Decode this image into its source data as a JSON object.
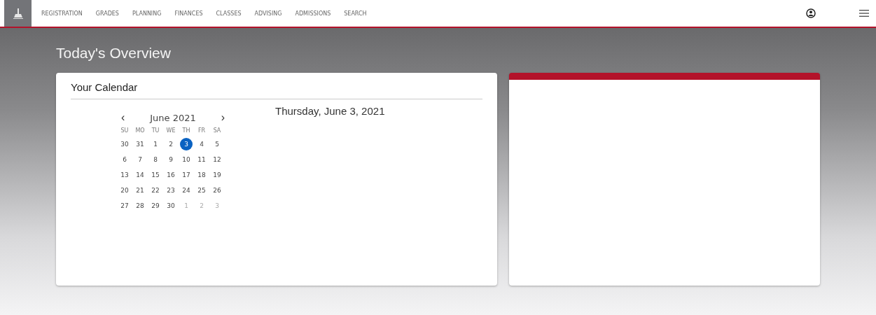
{
  "nav": {
    "items": [
      {
        "label": "REGISTRATION"
      },
      {
        "label": "GRADES"
      },
      {
        "label": "PLANNING"
      },
      {
        "label": "FINANCES"
      },
      {
        "label": "CLASSES"
      },
      {
        "label": "ADVISING"
      },
      {
        "label": "ADMISSIONS"
      },
      {
        "label": "SEARCH"
      }
    ]
  },
  "page_title": "Today's Overview",
  "calendar_card": {
    "title": "Your Calendar",
    "selected_date": "Thursday, June 3, 2021",
    "month": {
      "prev": "‹",
      "label": "June 2021",
      "next": "›"
    },
    "weekdays": [
      "SU",
      "MO",
      "TU",
      "WE",
      "TH",
      "FR",
      "SA"
    ],
    "weeks": [
      [
        {
          "day": "30",
          "selected": false,
          "muted": false
        },
        {
          "day": "31",
          "selected": false,
          "muted": false
        },
        {
          "day": "1",
          "selected": false,
          "muted": false
        },
        {
          "day": "2",
          "selected": false,
          "muted": false
        },
        {
          "day": "3",
          "selected": true,
          "muted": false
        },
        {
          "day": "4",
          "selected": false,
          "muted": false
        },
        {
          "day": "5",
          "selected": false,
          "muted": false
        }
      ],
      [
        {
          "day": "6",
          "selected": false,
          "muted": false
        },
        {
          "day": "7",
          "selected": false,
          "muted": false
        },
        {
          "day": "8",
          "selected": false,
          "muted": false
        },
        {
          "day": "9",
          "selected": false,
          "muted": false
        },
        {
          "day": "10",
          "selected": false,
          "muted": false
        },
        {
          "day": "11",
          "selected": false,
          "muted": false
        },
        {
          "day": "12",
          "selected": false,
          "muted": false
        }
      ],
      [
        {
          "day": "13",
          "selected": false,
          "muted": false
        },
        {
          "day": "14",
          "selected": false,
          "muted": false
        },
        {
          "day": "15",
          "selected": false,
          "muted": false
        },
        {
          "day": "16",
          "selected": false,
          "muted": false
        },
        {
          "day": "17",
          "selected": false,
          "muted": false
        },
        {
          "day": "18",
          "selected": false,
          "muted": false
        },
        {
          "day": "19",
          "selected": false,
          "muted": false
        }
      ],
      [
        {
          "day": "20",
          "selected": false,
          "muted": false
        },
        {
          "day": "21",
          "selected": false,
          "muted": false
        },
        {
          "day": "22",
          "selected": false,
          "muted": false
        },
        {
          "day": "23",
          "selected": false,
          "muted": false
        },
        {
          "day": "24",
          "selected": false,
          "muted": false
        },
        {
          "day": "25",
          "selected": false,
          "muted": false
        },
        {
          "day": "26",
          "selected": false,
          "muted": false
        }
      ],
      [
        {
          "day": "27",
          "selected": false,
          "muted": false
        },
        {
          "day": "28",
          "selected": false,
          "muted": false
        },
        {
          "day": "29",
          "selected": false,
          "muted": false
        },
        {
          "day": "30",
          "selected": false,
          "muted": false
        },
        {
          "day": "1",
          "selected": false,
          "muted": true
        },
        {
          "day": "2",
          "selected": false,
          "muted": true
        },
        {
          "day": "3",
          "selected": false,
          "muted": true
        }
      ]
    ]
  }
}
